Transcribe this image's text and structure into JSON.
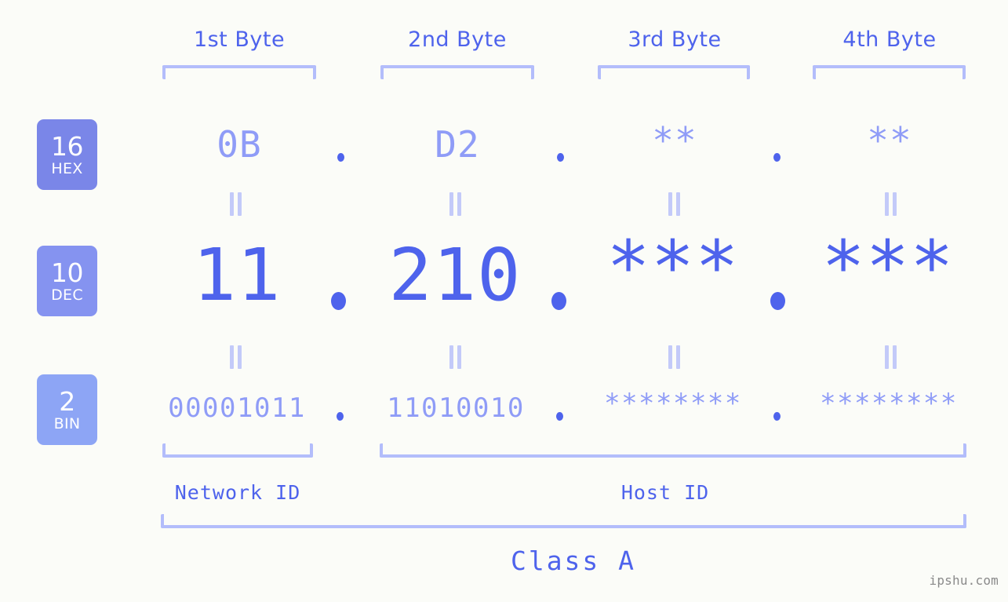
{
  "background_color": "#fbfcf8",
  "accent_color": "#4e63ec",
  "accent_light_color": "#8f9cf7",
  "bracket_color": "#b3bdfb",
  "byte_headers": [
    {
      "label": "1st Byte"
    },
    {
      "label": "2nd Byte"
    },
    {
      "label": "3rd Byte"
    },
    {
      "label": "4th Byte"
    }
  ],
  "bases": [
    {
      "number": "16",
      "name": "HEX",
      "color": "#7a86e8"
    },
    {
      "number": "10",
      "name": "DEC",
      "color": "#8593f0"
    },
    {
      "number": "2",
      "name": "BIN",
      "color": "#8da5f5"
    }
  ],
  "rows": {
    "hex": {
      "octets": [
        "0B",
        "D2",
        "**",
        "**"
      ],
      "separator": "."
    },
    "dec": {
      "octets": [
        "11",
        "210",
        "***",
        "***"
      ],
      "separator": "."
    },
    "bin": {
      "octets": [
        "00001011",
        "11010010",
        "********",
        "********"
      ],
      "separator": "."
    }
  },
  "equals_marks": [
    "=",
    "=",
    "=",
    "=",
    "=",
    "=",
    "=",
    "="
  ],
  "sections": [
    {
      "label": "Network ID"
    },
    {
      "label": "Host ID"
    }
  ],
  "class": {
    "label": "Class A"
  },
  "watermark": {
    "text": "ipshu.com"
  }
}
